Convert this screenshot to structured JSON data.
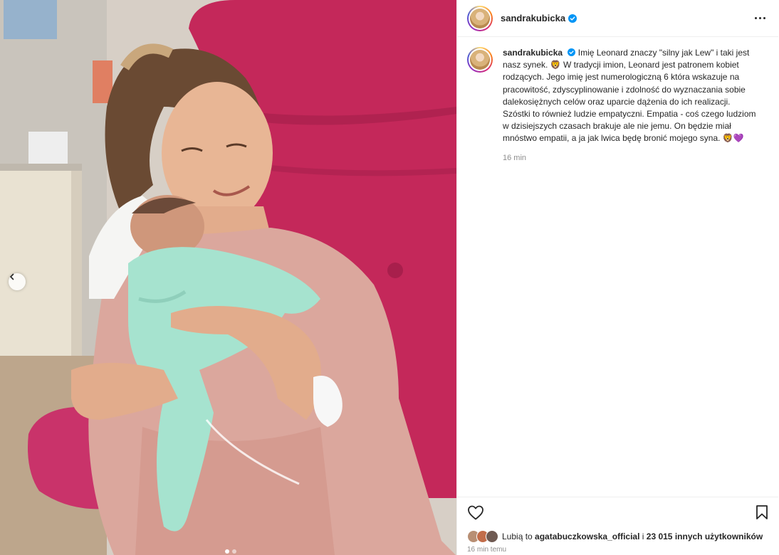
{
  "post": {
    "username": "sandrakubicka",
    "caption": "Imię Leonard znaczy \"silny jak Lew\" i taki jest nasz synek. 🦁 W tradycji imion, Leonard jest patronem kobiet rodzących. Jego imię jest numerologiczną 6 która wskazuje na pracowitość, zdyscyplinowanie i zdolność do wyznaczania sobie dalekosiężnych celów oraz uparcie dążenia do ich realizacji. Szóstki to również ludzie empatyczni. Empatia - coś czego ludziom w dzisiejszych czasach brakuje ale nie jemu. On będzie miał mnóstwo empatii, a ja jak lwica będę bronić mojego syna. 🦁💜",
    "caption_time": "16 min",
    "likes_prefix": "Lubią to",
    "likes_user": "agatabuczkowska_official",
    "likes_suffix": "i 23 015 innych użytkowników",
    "timestamp": "16 min temu"
  },
  "icons": {
    "verified": "verified-badge-icon",
    "more": "more-options-icon",
    "like": "heart-icon",
    "save": "bookmark-icon",
    "carousel_prev": "chevron-left-icon"
  },
  "colors": {
    "verified": "#0095f6",
    "chair": "#c4285a",
    "gown": "#dba79d",
    "blanket": "#a6e3cf"
  }
}
